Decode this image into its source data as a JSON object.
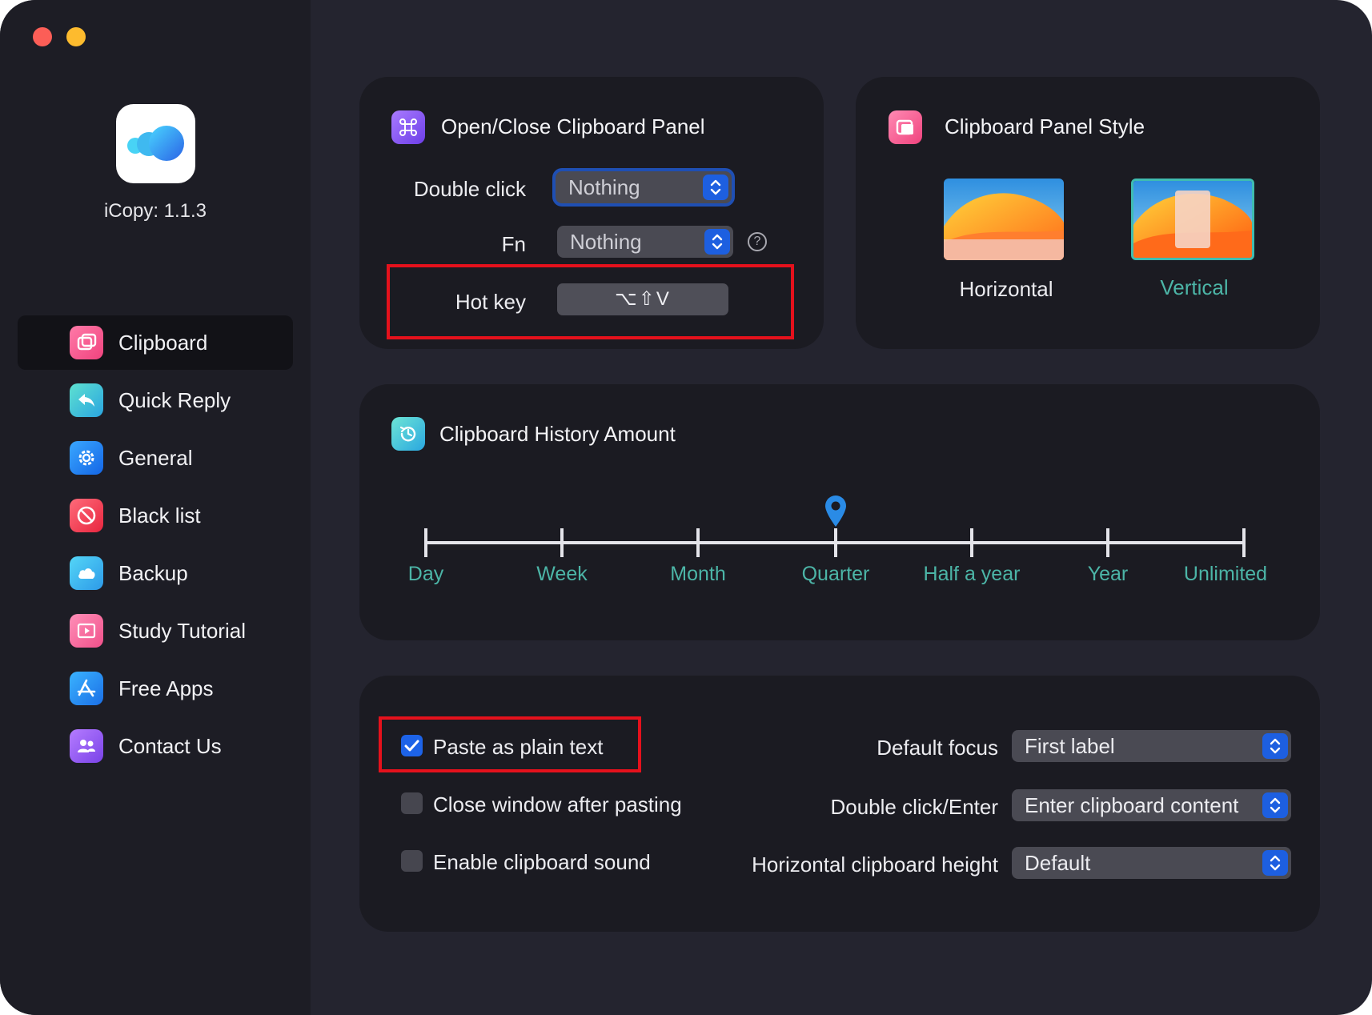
{
  "window": {
    "controls": [
      "close",
      "minimize"
    ]
  },
  "app": {
    "version_label": "iCopy: 1.1.3"
  },
  "sidebar": {
    "items": [
      {
        "label": "Clipboard",
        "icon": "clipboard-icon",
        "active": true
      },
      {
        "label": "Quick Reply",
        "icon": "reply-icon"
      },
      {
        "label": "General",
        "icon": "gear-icon"
      },
      {
        "label": "Black list",
        "icon": "prohibited-icon"
      },
      {
        "label": "Backup",
        "icon": "cloud-icon"
      },
      {
        "label": "Study Tutorial",
        "icon": "video-icon"
      },
      {
        "label": "Free Apps",
        "icon": "app-store-icon"
      },
      {
        "label": "Contact Us",
        "icon": "contacts-icon"
      }
    ]
  },
  "open_close": {
    "title": "Open/Close Clipboard Panel",
    "double_click_label": "Double click",
    "double_click_value": "Nothing",
    "fn_label": "Fn",
    "fn_value": "Nothing",
    "help": "?",
    "hotkey_label": "Hot key",
    "hotkey_value": "⌥⇧V"
  },
  "panel_style": {
    "title": "Clipboard Panel Style",
    "options": [
      {
        "label": "Horizontal",
        "selected": false
      },
      {
        "label": "Vertical",
        "selected": true
      }
    ]
  },
  "history": {
    "title": "Clipboard History Amount",
    "stops": [
      "Day",
      "Week",
      "Month",
      "Quarter",
      "Half a year",
      "Year",
      "Unlimited"
    ],
    "selected": "Quarter"
  },
  "options": {
    "paste_plain": {
      "label": "Paste as plain text",
      "checked": true
    },
    "close_after": {
      "label": "Close window after pasting",
      "checked": false
    },
    "sound": {
      "label": "Enable clipboard sound",
      "checked": false
    },
    "default_focus": {
      "label": "Default focus",
      "value": "First label"
    },
    "double_click_enter": {
      "label": "Double click/Enter",
      "value": "Enter clipboard content"
    },
    "horizontal_height": {
      "label": "Horizontal clipboard height",
      "value": "Default"
    }
  },
  "colors": {
    "accent": "#1d63e8",
    "teal_text": "#4cb5a7",
    "highlight_red": "#e5111c"
  }
}
